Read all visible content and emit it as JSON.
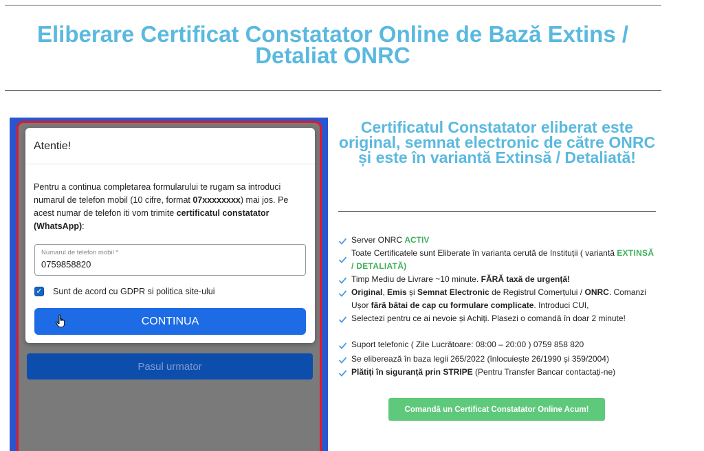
{
  "page": {
    "title": "Eliberare Certificat Constatator Online de Bază Extins / Detaliat ONRC"
  },
  "modal": {
    "title": "Atentie!",
    "body_1": "Pentru a continua completarea formularului te rugam sa introduci numarul de telefon mobil (10 cifre, format ",
    "body_format": "07xxxxxxxx",
    "body_2": ") mai jos. Pe acest numar de telefon iti vom trimite ",
    "body_bold": "certificatul constatator (WhatsApp)",
    "body_3": ":",
    "phone_label": "Numarul de telefon mobil *",
    "phone_value": "0759858820",
    "gdpr_checked": true,
    "gdpr_label": "Sunt de acord cu GDPR si politica site-ului",
    "continue_button": "CONTINUA"
  },
  "form": {
    "next_step_button": "Pasul urmator"
  },
  "right": {
    "heading": "Certificatul Constatator eliberat este original, semnat electronic de către ONRC și este în variantă Extinsă / Detaliată!",
    "features": {
      "f1_text": "Server ONRC ",
      "f1_status": "ACTIV",
      "f2_text": "Toate Certificatele sunt Eliberate în varianta cerută de Instituții ( variantă ",
      "f2_variant": "EXTINSĂ / DETALIATĂ)",
      "f3_text": "Timp Mediu de Livrare ~10 minute. ",
      "f3_bold": "FĂRĂ taxă de urgență!",
      "f4_b1": "Original",
      "f4_t1": ", ",
      "f4_b2": "Emis",
      "f4_t2": " și ",
      "f4_b3": "Semnat Electronic",
      "f4_t3": " de Registrul Comerțului / ",
      "f4_b4": "ONRC",
      "f4_t4": ". Comanzi Ușor ",
      "f4_b5": "fără bătai de cap cu formulare complicate",
      "f4_t5": ". Introduci CUI,",
      "f5_text": "Selectezi pentru ce ai nevoie și Achiți. Plasezi o comandă în doar 2 minute!",
      "f6_text": "Suport telefonic ( Zile Lucrătoare: 08:00 – 20:00 ) 0759 858 820",
      "f7_text": "Se eliberează în baza legii 265/2022 (înlocuiește 26/1990 și 359/2004)",
      "f8_bold": "Plătiți în siguranță prin STRIPE",
      "f8_text": " (Pentru Transfer Bancar contactați-ne)"
    },
    "cta_button": "Comandă un Certificat Constatator Online Acum!"
  },
  "colors": {
    "accent_title": "#5ab9df",
    "primary_button": "#1d6ce6",
    "form_border": "#e01b24",
    "success_green": "#5fc97b"
  },
  "icons": [
    "checkmark-icon",
    "hand-cursor-icon",
    "checkbox-checked-icon"
  ]
}
